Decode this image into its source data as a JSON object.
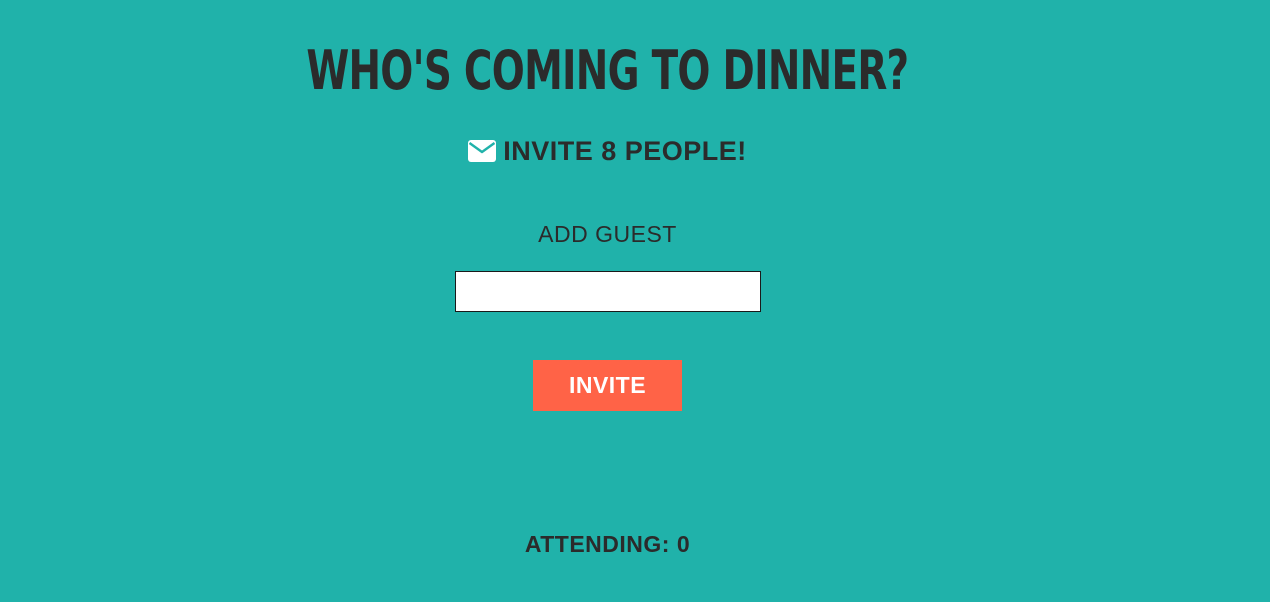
{
  "header": {
    "title": "WHO'S COMING TO DINNER?"
  },
  "invite": {
    "icon": "envelope-icon",
    "text": "INVITE 8 PEOPLE!"
  },
  "form": {
    "label": "ADD GUEST",
    "input_value": "",
    "button_label": "INVITE"
  },
  "status": {
    "attending_text": "ATTENDING: 0"
  },
  "colors": {
    "background": "#20b2aa",
    "button": "#ff6347",
    "text": "#2b2b2b"
  }
}
